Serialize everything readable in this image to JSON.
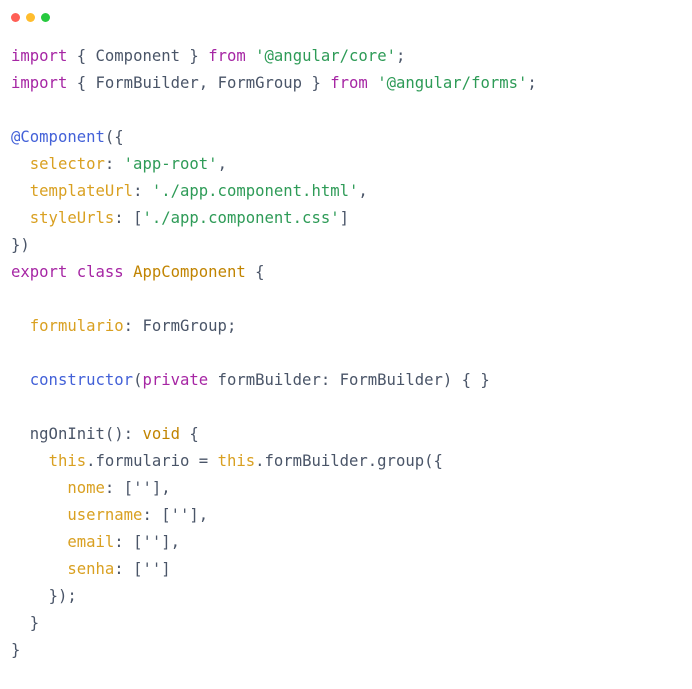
{
  "window": {
    "background": "#ffffff",
    "controls": [
      {
        "name": "close",
        "color": "#ff5f56"
      },
      {
        "name": "minimize",
        "color": "#ffbd2e"
      },
      {
        "name": "maximize",
        "color": "#27c93f"
      }
    ]
  },
  "editor": {
    "language": "typescript",
    "font_size_px": 15.6,
    "line_height_px": 27,
    "colors": {
      "background": "#ffffff",
      "plain": "#4a5568",
      "keyword": "#a626a4",
      "decorator": "#4361d8",
      "type": "#c18401",
      "property": "#d9a021",
      "string": "#2e9b57"
    },
    "lines": [
      {
        "n": 1,
        "text": "import { Component } from '@angular/core';"
      },
      {
        "n": 2,
        "text": "import { FormBuilder, FormGroup } from '@angular/forms';"
      },
      {
        "n": 3,
        "text": ""
      },
      {
        "n": 4,
        "text": "@Component({"
      },
      {
        "n": 5,
        "text": "  selector: 'app-root',"
      },
      {
        "n": 6,
        "text": "  templateUrl: './app.component.html',"
      },
      {
        "n": 7,
        "text": "  styleUrls: ['./app.component.css']"
      },
      {
        "n": 8,
        "text": "})"
      },
      {
        "n": 9,
        "text": "export class AppComponent {"
      },
      {
        "n": 10,
        "text": ""
      },
      {
        "n": 11,
        "text": "  formulario: FormGroup;"
      },
      {
        "n": 12,
        "text": ""
      },
      {
        "n": 13,
        "text": "  constructor(private formBuilder: FormBuilder) { }"
      },
      {
        "n": 14,
        "text": ""
      },
      {
        "n": 15,
        "text": "  ngOnInit(): void {"
      },
      {
        "n": 16,
        "text": "    this.formulario = this.formBuilder.group({"
      },
      {
        "n": 17,
        "text": "      nome: [''],"
      },
      {
        "n": 18,
        "text": "      username: [''],"
      },
      {
        "n": 19,
        "text": "      email: [''],"
      },
      {
        "n": 20,
        "text": "      senha: ['']"
      },
      {
        "n": 21,
        "text": "    });"
      },
      {
        "n": 22,
        "text": "  }"
      },
      {
        "n": 23,
        "text": "}"
      }
    ],
    "tokens": {
      "l1": {
        "kw_import": "import",
        "brace_open": " { ",
        "component": "Component",
        "brace_close": " } ",
        "kw_from": "from",
        "space": " ",
        "str": "'@angular/core'",
        "semi": ";"
      },
      "l2": {
        "kw_import": "import",
        "brace_open": " { ",
        "formbuilder": "FormBuilder, FormGroup",
        "brace_close": " } ",
        "kw_from": "from",
        "space": " ",
        "str": "'@angular/forms'",
        "semi": ";"
      },
      "l4": {
        "decorator": "@Component",
        "punct": "({"
      },
      "l5": {
        "indent": "  ",
        "key": "selector",
        "colon": ": ",
        "str": "'app-root'",
        "comma": ","
      },
      "l6": {
        "indent": "  ",
        "key": "templateUrl",
        "colon": ": ",
        "str": "'./app.component.html'",
        "comma": ","
      },
      "l7": {
        "indent": "  ",
        "key": "styleUrls",
        "colon": ": ",
        "bracket_open": "[",
        "str": "'./app.component.css'",
        "bracket_close": "]"
      },
      "l8": {
        "punct": "})"
      },
      "l9": {
        "kw_export": "export",
        "space1": " ",
        "kw_class": "class",
        "space2": " ",
        "name": "AppComponent",
        "brace": " {"
      },
      "l11": {
        "indent": "  ",
        "field": "formulario",
        "colon": ": ",
        "type": "FormGroup;"
      },
      "l13": {
        "indent": "  ",
        "ctor": "constructor",
        "paren": "(",
        "kw_private": "private",
        "params": " formBuilder: FormBuilder) { }"
      },
      "l15": {
        "indent": "  ",
        "method": "ngOnInit(): ",
        "type": "void",
        "brace": " {"
      },
      "l16": {
        "indent": "    ",
        "this1": "this",
        "mid1": ".formulario = ",
        "this2": "this",
        "mid2": ".formBuilder.group({"
      },
      "l17": {
        "indent": "      ",
        "key": "nome",
        "rest": ": [''],"
      },
      "l18": {
        "indent": "      ",
        "key": "username",
        "rest": ": [''],"
      },
      "l19": {
        "indent": "      ",
        "key": "email",
        "rest": ": [''],"
      },
      "l20": {
        "indent": "      ",
        "key": "senha",
        "rest": ": ['']"
      },
      "l21": {
        "indent": "    ",
        "rest": "});"
      },
      "l22": {
        "indent": "  ",
        "rest": "}"
      },
      "l23": {
        "rest": "}"
      }
    }
  }
}
